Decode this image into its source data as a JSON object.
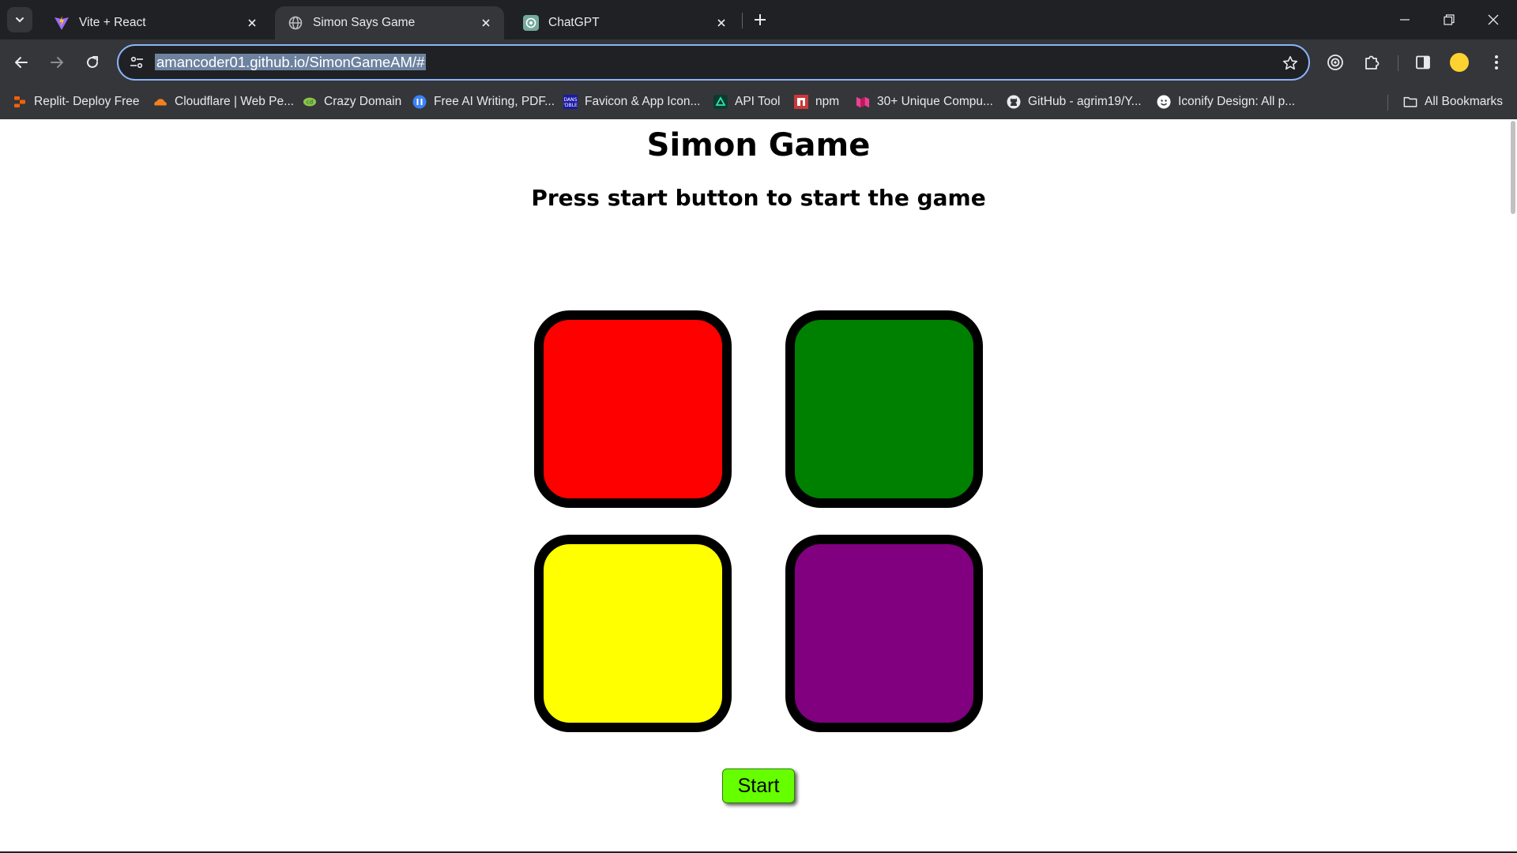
{
  "tabs": [
    {
      "title": "Vite + React",
      "icon": "vite-icon",
      "active": false
    },
    {
      "title": "Simon Says Game",
      "icon": "globe-icon",
      "active": true
    },
    {
      "title": "ChatGPT",
      "icon": "chatgpt-icon",
      "active": false
    }
  ],
  "address_bar": {
    "url": "amancoder01.github.io/SimonGameAM/#"
  },
  "bookmarks": [
    {
      "label": "Replit- Deploy Free",
      "icon": "replit-icon"
    },
    {
      "label": "Cloudflare | Web Pe...",
      "icon": "cloudflare-icon"
    },
    {
      "label": "Crazy Domain",
      "icon": "crazy-domain-icon"
    },
    {
      "label": "Free AI Writing, PDF...",
      "icon": "ai-writing-icon"
    },
    {
      "label": "Favicon & App Icon...",
      "icon": "favicon-icon"
    },
    {
      "label": "API Tool",
      "icon": "api-tool-icon"
    },
    {
      "label": "npm",
      "icon": "npm-icon"
    },
    {
      "label": "30+ Unique Compu...",
      "icon": "bookmark-site-icon"
    },
    {
      "label": "GitHub - agrim19/Y...",
      "icon": "github-icon"
    },
    {
      "label": "Iconify Design: All p...",
      "icon": "iconify-icon"
    }
  ],
  "all_bookmarks_label": "All Bookmarks",
  "page": {
    "title": "Simon Game",
    "subtitle": "Press start button to start the game",
    "start_label": "Start",
    "colors": {
      "red": "#ff0000",
      "green": "#008000",
      "yellow": "#ffff00",
      "purple": "#800080"
    }
  }
}
